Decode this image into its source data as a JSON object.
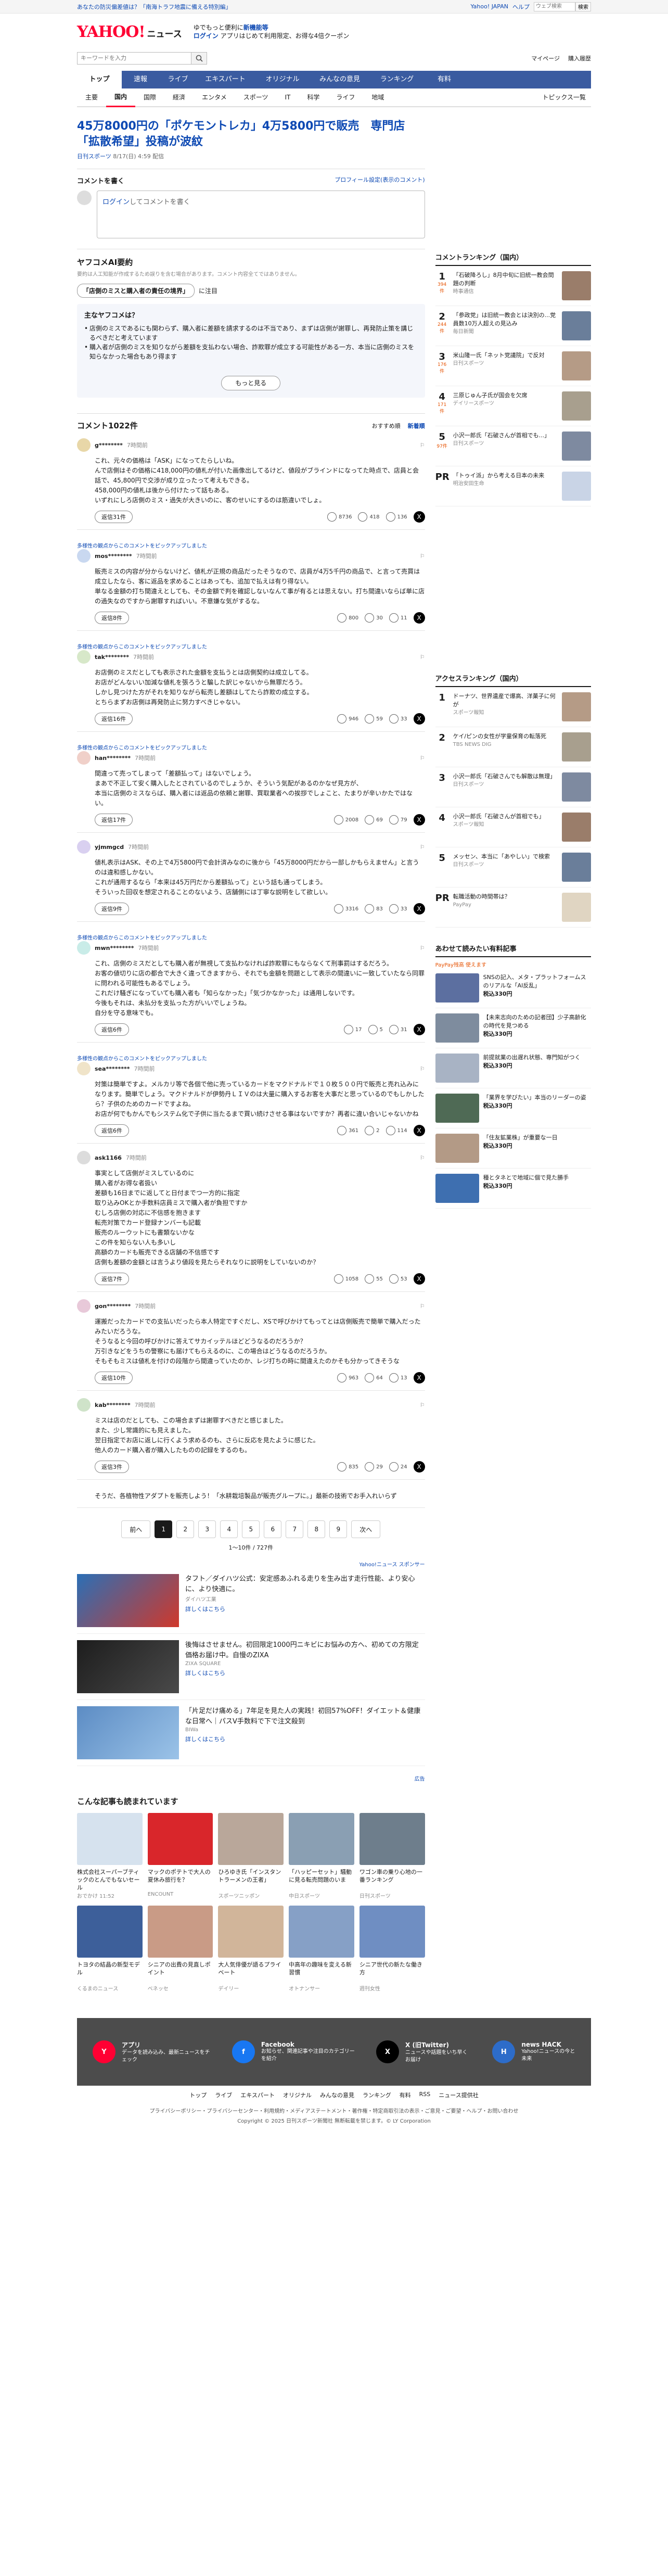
{
  "topbar": {
    "notice": "あなたの防災偏差値は？「南海トラフ地震に備える特別編」",
    "links": [
      "Yahoo! JAPAN",
      "ヘルプ"
    ],
    "search_placeholder": "ウェブ検索",
    "search_button": "検索"
  },
  "header": {
    "logo": "YAHOO!",
    "logo_sub": "ニュース",
    "promo_line1": "ゆでもっと便利に",
    "promo_emph": "新機能等",
    "promo_login": "ログイン",
    "promo_line2": "アプリはじめて利用限定、お得な4倍クーポン"
  },
  "search": {
    "placeholder": "キーワードを入力",
    "mypage": "マイページ",
    "buy": "購入履歴"
  },
  "gnav": [
    "トップ",
    "速報",
    "ライブ",
    "エキスパート",
    "オリジナル",
    "みんなの意見",
    "ランキング",
    "有料"
  ],
  "snav": [
    "主要",
    "国内",
    "国際",
    "経済",
    "エンタメ",
    "スポーツ",
    "IT",
    "科学",
    "ライフ",
    "地域"
  ],
  "snav_more": "トピックス一覧",
  "article": {
    "title": "45万8000円の「ポケモントレカ」4万5800円で販売　専門店「拡散希望」投稿が波紋",
    "source": "日刊スポーツ",
    "date": "8/17(日) 4:59 配信"
  },
  "comment_box": {
    "heading": "コメントを書く",
    "profile_link": "プロフィール設定(表示のコメント)",
    "login": "ログイン",
    "cta": "してコメントを書く"
  },
  "ai": {
    "title": "ヤフコメAI要約",
    "note": "要約は人工知能が作成するため誤りを含む場合があります。コメント内容全てではありません。",
    "tag": "「店側のミスと購入者の責任の境界」",
    "tag_suffix": "に注目",
    "card_title": "主なヤフコメは？",
    "points": [
      "店側のミスであるにも関わらず、購入者に差額を請求するのは不当であり、まずは店側が謝罪し、再発防止策を講じるべきだと考えています",
      "購入者が店側のミスを知りながら差額を支払わない場合、詐欺罪が成立する可能性がある一方、本当に店側のミスを知らなかった場合もあり得ます"
    ],
    "more": "もっと見る"
  },
  "comments_header": {
    "count": "コメント1022件",
    "sort_rec": "おすすめ順",
    "sort_new": "新着順"
  },
  "comments": [
    {
      "user": "g********",
      "time": "7時間前",
      "body": "これ、元々の価格は「ASK」になってたらしいね。\nんで店側はその価格に418,000円の値札が付いた画像出してるけど、値段がブラインドになってた時点で、店員と会話で、45,800円で交渉が成り立ったって考えもできる。\n458,000円の値札は後から付けたって話もある。\nいずれにしろ店側のミス・過失が大きいのに、客のせいにするのは筋違いでしょ。",
      "replies": "返信31件",
      "reacts": [
        "8736",
        "418",
        "136"
      ],
      "expert": ""
    },
    {
      "user": "mos********",
      "time": "7時間前",
      "body": "販売ミスの内容が分からないけど、値札が正規の商品だったそうなので、店員が4万5千円の商品で、と言って売買は成立したなら、客に返品を求めることはあっても、追加で払えは有り得ない。\n単なる金額の打ち間違えとしても、その金額で判を確認しないなんて事が有るとは思えない。打ち間違いならば単に店の過失なのですから謝罪すればいい。不意嫌な気がするな。",
      "replies": "返信8件",
      "reacts": [
        "800",
        "30",
        "11"
      ],
      "expert": "多様性の観点からこのコメントをピックアップしました"
    },
    {
      "user": "tak********",
      "time": "7時間前",
      "body": "お店側のミスだとしても表示された金額を支払うとは店側契約は成立してる。\nお店がどんないい加減な値札を張ろうと騙した訳じゃないから無罪だろう。\nしかし見つけた方がそれを知りながら転売し差額はしてたら詐欺の成立する。\nとちらまずお店側は再発防止に努力すべきじゃない。",
      "replies": "返信16件",
      "reacts": [
        "946",
        "59",
        "33"
      ],
      "expert": "多様性の観点からこのコメントをピックアップしました"
    },
    {
      "user": "han********",
      "time": "7時間前",
      "body": "間違って売ってしまって「差額払って」はないでしょう。\nまあで不正して安く購入したとされているのでしょうか、そういう気配があるのかなぜ見方が、\n本当に店側のミスならば、購入者には返品の依頼と謝罪、買取業者への挨拶でしょこと、たまりが辛いかたではない。",
      "replies": "返信17件",
      "reacts": [
        "2008",
        "69",
        "79"
      ],
      "expert": "多様性の観点からこのコメントをピックアップしました"
    },
    {
      "user": "yjmmgcd",
      "time": "7時間前",
      "body": "値札表示はASK、その上で4万5800円で会計済みなのに後から「45万8000円だから一部しかもらえません」と言うのは違和感しかない。\nこれが通用するなら「本来は45万円だから差額払って」という話も通ってしまう。\nそういった回収を想定されることのないよう、店舗側には丁寧な説明をして欲しい。",
      "replies": "返信9件",
      "reacts": [
        "3316",
        "83",
        "33"
      ],
      "expert": ""
    },
    {
      "user": "mwn********",
      "time": "7時間前",
      "body": "これ、店側のミスだとしても購入者が無視して支払わなければ詐欺罪にもならなくて刑事罰はするだろう。\nお客の値切りに店の都合で大きく違ってきますから、それでも金額を問題として表示の間違いに一致していたなら同罪に問われる可能性もあるでしょう。\nこれだけ騒ぎになっていても購入者も「知らなかった」「気づかなかった」は通用しないです。\n今後もそれは、未払分を支払った方がいいでしょうね。\n自分を守る意味でも。",
      "replies": "返信6件",
      "reacts": [
        "17",
        "5",
        "31"
      ],
      "expert": "多様性の観点からこのコメントをピックアップしました"
    },
    {
      "user": "sea********",
      "time": "7時間前",
      "body": "対策は簡単ですよ。メルカリ等で各個で他に売っているカードをマクドナルドで１０枚５００円で販売と売れ込みになります。簡単でしょう。マクドナルドが伊勢丹ＬＩＶのは大量に購入するお客を大事だと思っているのでもしかしたら？子供のためのカードですよね。\nお店が何でもかんでもシステム化で子供に当たるまで買い続けさせる事はないですか？再者に違い合いじゃないかね",
      "replies": "返信6件",
      "reacts": [
        "361",
        "2",
        "114"
      ],
      "expert": "多様性の観点からこのコメントをピックアップしました"
    },
    {
      "user": "ask1166",
      "time": "7時間前",
      "body": "事実として店側がミスしているのに\n購入者がお得な者扱い\n差額も16日までに返してと日付までつ一方的に指定\n取り込みOKとか手数料店員ミスで購入者が負担ですか\nむしろ店側の対応に不信感を抱きます\n転売対策でカード登録ナンバーも記載\n販売のルーウットにも書類ないかな\nこの件を知らない人も多いし\n高額のカードも販売できる店舗の不信感です\n店側も差額の金額とは言うより値段を見たらそれなりに説明をしていないのか？",
      "replies": "返信7件",
      "reacts": [
        "1058",
        "55",
        "53"
      ],
      "expert": ""
    },
    {
      "user": "gon********",
      "time": "7時間前",
      "body": "運搬だったカードでの支払いだったら本人特定ですぐだし、XSで呼びかけてもってとは店側販売で簡単で購入だったみたいだろうな。\nそうなると今回の呼びかけに答えてサカイッテルほどどうなるのだろうか？\n万引きなどをうちの警察にも届けてもらえるのに、この場合はどうなるのだろうか。\nそもそもミスは値札を付けの段階から間違っていたのか、レジ打ちの時に間違えたのかそも分かってきそうな",
      "replies": "返信10件",
      "reacts": [
        "963",
        "64",
        "13"
      ],
      "expert": ""
    },
    {
      "user": "kab********",
      "time": "7時間前",
      "body": "ミスは店のだとしても、この場合まずは謝罪すべきだと感じました。\nまた、少し常識的にも見えました。\n翌日指定でお店に返しに行くよう求めるのも、さらに反応を見たように感じた。\n他人のカード購入者が購入したものの記録をするのも。",
      "replies": "返信3件",
      "reacts": [
        "835",
        "29",
        "24"
      ],
      "expert": ""
    }
  ],
  "promo_comment": "そうだ、各植物性アダプトを販売しよう！「水耕栽培製品が販売グループに。」最新の技術でお手入れいらず",
  "pagination": {
    "prev": "前へ",
    "next": "次へ",
    "pages": [
      "1",
      "2",
      "3",
      "4",
      "5",
      "6",
      "7",
      "8",
      "9"
    ],
    "current": "1",
    "count": "1〜10件 / 727件"
  },
  "ad_label": "Yahoo!ニュース スポンサー",
  "ads": [
    {
      "text": "タフト／ダイハツ公式：安定感あふれる走りを生み出す走行性能、より安心に、より快適に。",
      "sponsor": "ダイハツ工業",
      "link": "詳しくはこちら"
    },
    {
      "text": "後悔はさせません。初回限定1000円ニキビにお悩みの方へ、初めての方限定価格お届け中。自慢のZIXA",
      "sponsor": "ZIXA SQUARE",
      "link": "詳しくはこちら"
    },
    {
      "text": "「片足だけ痛める」7年足を見た人の実践！初回57%OFF！ダイエット＆健康な日常へ｜パスV手数料で下で注文殺到",
      "sponsor": "BIWa",
      "link": "詳しくはこちら"
    }
  ],
  "ad_footer": "広告",
  "rec_title": "こんな記事も読まれています",
  "recs": [
    {
      "t": "株式会社スーパーブティックのとんでもないセール",
      "s": "おでかけ 11:52"
    },
    {
      "t": "マックのポテトで大人の夏休み旅行を？",
      "s": "ENCOUNT"
    },
    {
      "t": "ひろゆき氏「インスタントラーメンの王者」",
      "s": "スポーツニッポン"
    },
    {
      "t": "「ハッピーセット」騒動に見る転売問題のいま",
      "s": "中日スポーツ"
    },
    {
      "t": "ワゴン車の乗り心地の一番ランキング",
      "s": "日刊スポーツ"
    },
    {
      "t": "トヨタの結晶の新型モデル",
      "s": "くるまのニュース"
    },
    {
      "t": "シニアの出費の見直しポイント",
      "s": "ベネッセ"
    },
    {
      "t": "大人気俳優が語るプライベート",
      "s": "デイリー"
    },
    {
      "t": "中高年の趣味を変える新習慣",
      "s": "オトナンサー"
    },
    {
      "t": "シニア世代の新たな働き方",
      "s": "週刊女性"
    }
  ],
  "rank_title": "コメントランキング（国内）",
  "rankings": [
    {
      "n": "1",
      "c": "394件",
      "t": "「石破降ろし」8月中旬に旧統一教会問題の判断",
      "s": "時事通信"
    },
    {
      "n": "2",
      "c": "244件",
      "t": "「参政党」は旧統一教会とは決別の...党員数10万人超えの見込み",
      "s": "毎日新聞"
    },
    {
      "n": "3",
      "c": "176件",
      "t": "米山隆一氏「ネット党議院」で反対",
      "s": "日刊スポーツ"
    },
    {
      "n": "4",
      "c": "171件",
      "t": "三原じゅん子氏が国会を欠席",
      "s": "デイリースポーツ"
    },
    {
      "n": "5",
      "c": "97件",
      "t": "小沢一郎氏「石破さんが首相でも...」",
      "s": "日刊スポーツ"
    }
  ],
  "pr": {
    "label": "PR",
    "t": "「トゥイ派」から考える日本の未来",
    "s": "明治安田生命"
  },
  "access_title": "アクセスランキング（国内）",
  "access": [
    {
      "n": "1",
      "t": "ドーナツ、世界遺産で爆高、洋菓子に何が",
      "s": "スポーツ報知"
    },
    {
      "n": "2",
      "t": "ケイ/ピンの女性が学童保育の転落死",
      "s": "TBS NEWS DIG"
    },
    {
      "n": "3",
      "t": "小沢一郎氏「石破さんでも解散は無理」",
      "s": "日刊スポーツ"
    },
    {
      "n": "4",
      "t": "小沢一郎氏「石破さんが首相でも」",
      "s": "スポーツ報知"
    },
    {
      "n": "5",
      "t": "メッセン、本当に「あやしい」で検索",
      "s": "日刊スポーツ"
    }
  ],
  "access_pr": {
    "label": "PR",
    "t": "転職活動の時間帯は？",
    "s": "PayPay"
  },
  "special_title": "あわせて読みたい有料記事",
  "special_sub": "PayPay残高 使えます",
  "specials": [
    {
      "t": "SNSの記入、メタ・プラットフォームスのリアルな「AI反乱」",
      "p": "税込330円"
    },
    {
      "t": "【未来志向のための記者団】少子高齢化の時代を見つめる",
      "p": "税込330円"
    },
    {
      "t": "前提就業の出遅れ状態、専門知がつく",
      "p": "税込330円"
    },
    {
      "t": "「業界を学びたい」本当のリーダーの姿",
      "p": "税込330円"
    },
    {
      "t": "「住友鉱業株」が重要な一日",
      "p": "税込330円"
    },
    {
      "t": "種とタネとで地域に個で見た勝手",
      "p": "税込330円"
    }
  ],
  "footer": [
    {
      "t": "アプリ",
      "d": "データを読み込み、最新ニュースをチェック"
    },
    {
      "t": "Facebook",
      "d": "お知らせ、関連記事や注目のカテゴリーを紹介"
    },
    {
      "t": "X (旧Twitter)",
      "d": "ニュースや話題をいち早くお届け"
    },
    {
      "t": "news HACK",
      "d": "Yahoo!ニュースの今と未来"
    }
  ],
  "fnav": [
    "トップ",
    "ライブ",
    "エキスパート",
    "オリジナル",
    "みんなの意見",
    "ランキング",
    "有料",
    "RSS",
    "ニュース提供社"
  ],
  "flinks": "プライバシーポリシー・プライバシーセンター・利用規約・メディアステートメント・著作権・特定商取引法の表示・ご意見・ご要望・ヘルプ・お問い合わせ",
  "copyright": "Copyright © 2025 日刊スポーツ新聞社 無断転載を禁じます。© LY Corporation",
  "colors": {
    "brand": "#ff0033",
    "nav": "#3a5ba0",
    "link": "#0d49b3"
  }
}
